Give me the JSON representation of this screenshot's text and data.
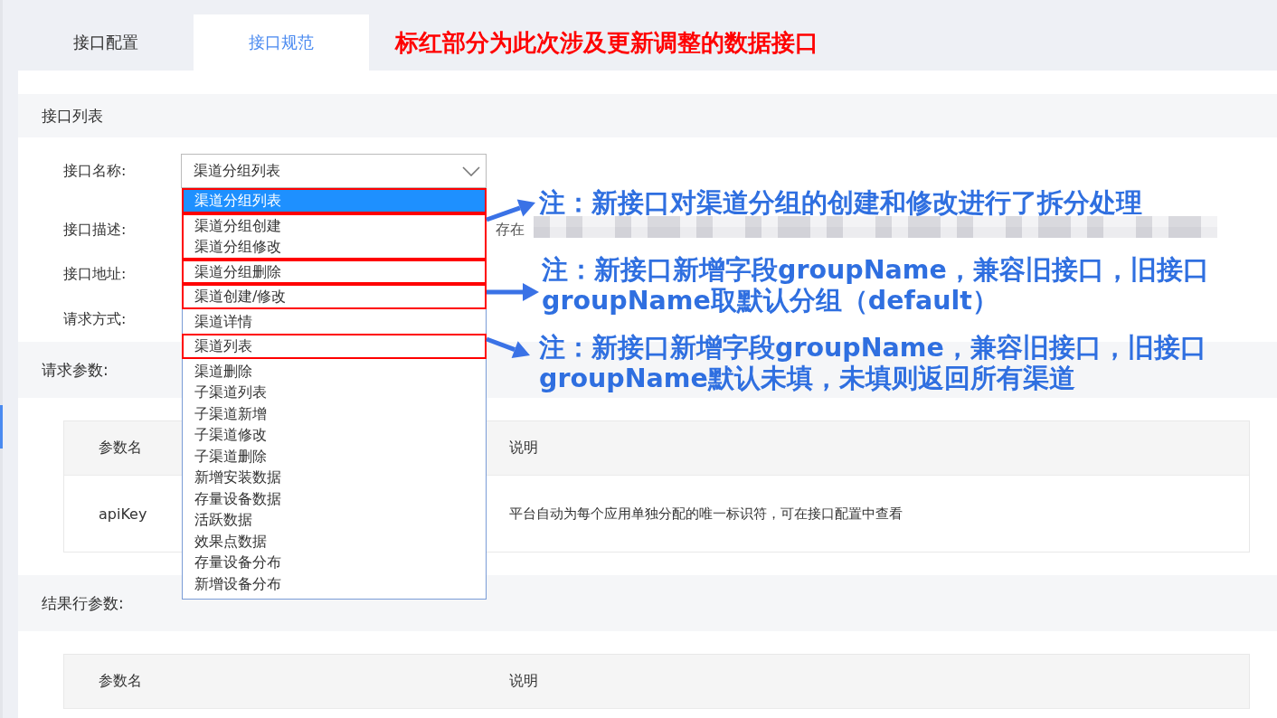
{
  "tabs": [
    {
      "label": "接口配置",
      "selected": false
    },
    {
      "label": "接口规范",
      "selected": true
    }
  ],
  "headline": "标红部分为此次涉及更新调整的数据接口",
  "section_title": "接口列表",
  "form": {
    "name_label": "接口名称:",
    "select_value": "渠道分组列表",
    "desc_label": "接口描述:",
    "desc_text": "存在",
    "address_label": "接口地址:",
    "method_label": "请求方式:"
  },
  "dropdown": [
    {
      "marked": true,
      "items": [
        {
          "label": "渠道分组列表",
          "selected": true
        }
      ]
    },
    {
      "marked": true,
      "items": [
        {
          "label": "渠道分组创建",
          "selected": false
        },
        {
          "label": "渠道分组修改",
          "selected": false
        }
      ]
    },
    {
      "marked": true,
      "items": [
        {
          "label": "渠道分组删除",
          "selected": false
        }
      ]
    },
    {
      "marked": true,
      "items": [
        {
          "label": "渠道创建/修改",
          "selected": false
        }
      ]
    },
    {
      "marked": false,
      "items": [
        {
          "label": "渠道详情",
          "selected": false
        }
      ]
    },
    {
      "marked": true,
      "items": [
        {
          "label": "渠道列表",
          "selected": false
        }
      ]
    },
    {
      "marked": false,
      "items": [
        {
          "label": "渠道删除",
          "selected": false
        },
        {
          "label": "子渠道列表",
          "selected": false
        },
        {
          "label": "子渠道新增",
          "selected": false
        },
        {
          "label": "子渠道修改",
          "selected": false
        },
        {
          "label": "子渠道删除",
          "selected": false
        },
        {
          "label": "新增安装数据",
          "selected": false
        },
        {
          "label": "存量设备数据",
          "selected": false
        },
        {
          "label": "活跃数据",
          "selected": false
        },
        {
          "label": "效果点数据",
          "selected": false
        },
        {
          "label": "存量设备分布",
          "selected": false
        },
        {
          "label": "新增设备分布",
          "selected": false
        }
      ]
    }
  ],
  "notes": [
    {
      "lines": [
        "注：新接口对渠道分组的创建和修改进行了拆分处理"
      ]
    },
    {
      "lines": [
        "注：新接口新增字段groupName，兼容旧接口，旧接口",
        "groupName取默认分组（default）"
      ]
    },
    {
      "lines": [
        "注：新接口新增字段groupName，兼容旧接口，旧接口",
        "groupName默认未填，未填则返回所有渠道"
      ]
    }
  ],
  "request_params": {
    "title": "请求参数:",
    "columns": [
      "参数名",
      "说明"
    ],
    "rows": [
      [
        "apiKey",
        "平台自动为每个应用单独分配的唯一标识符，可在接口配置中查看"
      ]
    ]
  },
  "result_params": {
    "title": "结果行参数:",
    "columns": [
      "参数名",
      "说明"
    ]
  }
}
